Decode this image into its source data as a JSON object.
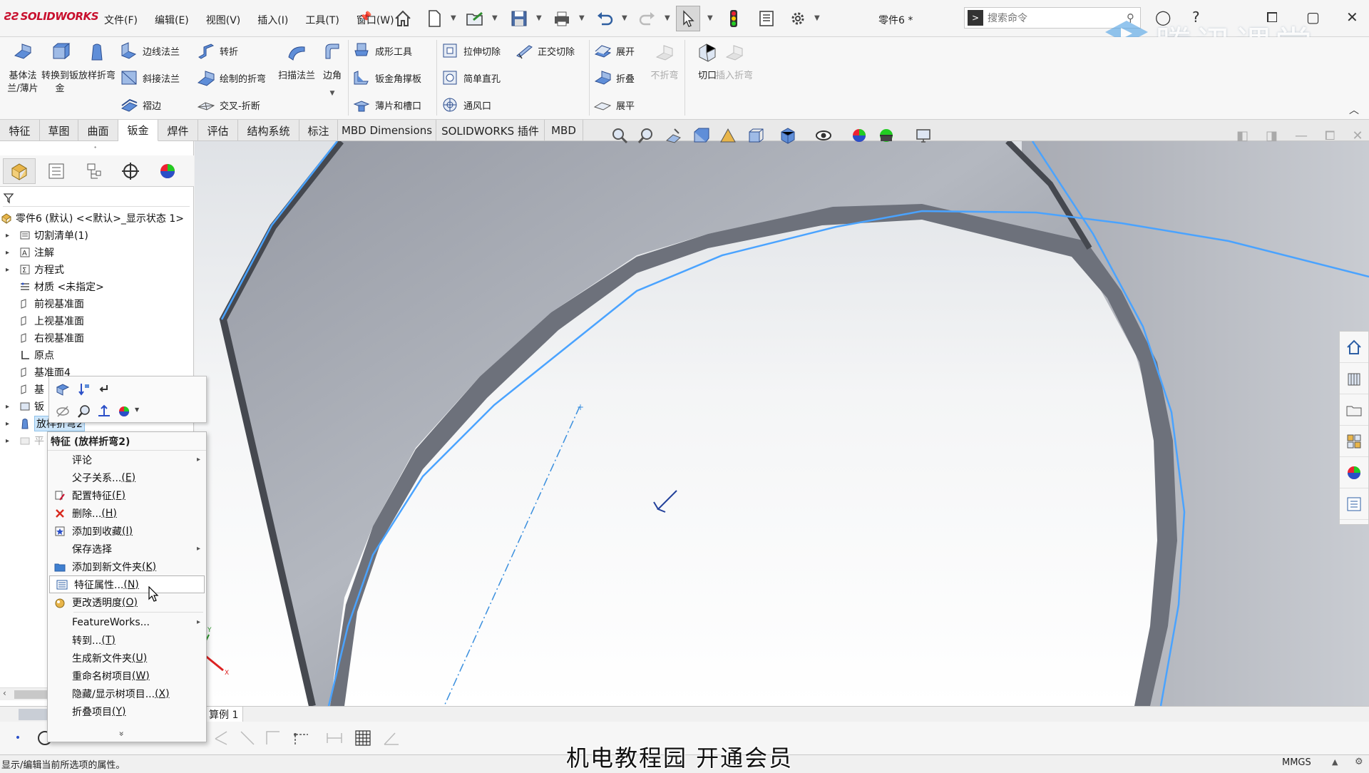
{
  "titlebar": {
    "logo": "SOLIDWORKS",
    "menus": [
      "文件(F)",
      "编辑(E)",
      "视图(V)",
      "插入(I)",
      "工具(T)",
      "窗口(W)"
    ],
    "doc_title": "零件6 *",
    "search_placeholder": "搜索命令",
    "watermark": "腾讯课堂"
  },
  "ribbon": {
    "big": [
      {
        "label": "基体法兰/薄片",
        "icon": "base-flange-icon"
      },
      {
        "label": "转换到钣金",
        "icon": "convert-sheetmetal-icon"
      },
      {
        "label": "放样折弯",
        "icon": "lofted-bend-icon"
      }
    ],
    "col1": [
      "边线法兰",
      "斜接法兰",
      "褶边"
    ],
    "col2": [
      "转折",
      "绘制的折弯",
      "交叉-折断"
    ],
    "big2": [
      {
        "label": "扫描法兰",
        "icon": "swept-flange-icon"
      },
      {
        "label": "边角",
        "icon": "corner-icon"
      }
    ],
    "col3": [
      "成形工具",
      "钣金角撑板",
      "薄片和槽口"
    ],
    "col4": [
      "拉伸切除",
      "简单直孔",
      "通风口"
    ],
    "col5": [
      "正交切除"
    ],
    "col6": [
      "展开",
      "折叠",
      "展平"
    ],
    "big3": [
      {
        "label": "不折弯",
        "icon": "no-bends-icon",
        "disabled": true
      },
      {
        "label": "切口",
        "icon": "rip-icon",
        "disabled": false
      },
      {
        "label": "插入折弯",
        "icon": "insert-bends-icon",
        "disabled": true
      }
    ]
  },
  "tabs": [
    "特征",
    "草图",
    "曲面",
    "钣金",
    "焊件",
    "评估",
    "结构系统",
    "标注",
    "MBD Dimensions",
    "SOLIDWORKS 插件",
    "MBD"
  ],
  "active_tab": "钣金",
  "tree": {
    "root": "零件6 (默认) <<默认>_显示状态 1>",
    "nodes": [
      {
        "label": "切割清单(1)",
        "icon": "cutlist-icon",
        "expandable": true
      },
      {
        "label": "注解",
        "icon": "annotations-icon",
        "expandable": true
      },
      {
        "label": "方程式",
        "icon": "equations-icon",
        "expandable": true
      },
      {
        "label": "材质 <未指定>",
        "icon": "material-icon",
        "expandable": false
      },
      {
        "label": "前视基准面",
        "icon": "plane-icon",
        "expandable": false
      },
      {
        "label": "上视基准面",
        "icon": "plane-icon",
        "expandable": false
      },
      {
        "label": "右视基准面",
        "icon": "plane-icon",
        "expandable": false
      },
      {
        "label": "原点",
        "icon": "origin-icon",
        "expandable": false
      },
      {
        "label": "基准面4",
        "icon": "plane-icon",
        "expandable": false
      },
      {
        "label": "基",
        "icon": "plane-icon",
        "expandable": false
      },
      {
        "label": "钣",
        "icon": "sheetmetal-icon",
        "expandable": true
      },
      {
        "label": "放样折弯2",
        "icon": "lofted-bend-icon",
        "expandable": true,
        "selected": true
      },
      {
        "label": "平",
        "icon": "flat-pattern-icon",
        "expandable": true,
        "greyed": true
      }
    ]
  },
  "context_menu": {
    "header": "特征 (放样折弯2)",
    "items": [
      {
        "label": "评论",
        "key": "",
        "submenu": true,
        "icon": ""
      },
      {
        "label": "父子关系... ",
        "key": "(E)",
        "icon": ""
      },
      {
        "label": "配置特征 ",
        "key": "(F)",
        "icon": "configure-feature-icon"
      },
      {
        "label": "删除... ",
        "key": "(H)",
        "icon": "delete-icon"
      },
      {
        "label": "添加到收藏 ",
        "key": "(I)",
        "icon": "favorite-icon"
      },
      {
        "label": "保存选择",
        "key": "",
        "submenu": true,
        "icon": ""
      },
      {
        "label": "添加到新文件夹 ",
        "key": "(K)",
        "icon": "new-folder-icon"
      },
      {
        "label": "特征属性... ",
        "key": "(N)",
        "icon": "feature-properties-icon",
        "hover": true
      },
      {
        "label": "更改透明度 ",
        "key": "(O)",
        "icon": "transparency-icon"
      },
      {
        "label": "FeatureWorks...",
        "key": "",
        "submenu": true,
        "icon": ""
      },
      {
        "label": "转到... ",
        "key": "(T)",
        "icon": ""
      },
      {
        "label": "生成新文件夹 ",
        "key": "(U)",
        "icon": ""
      },
      {
        "label": "重命名树项目 ",
        "key": "(W)",
        "icon": ""
      },
      {
        "label": "隐藏/显示树项目... ",
        "key": "(X)",
        "icon": ""
      },
      {
        "label": "折叠项目 ",
        "key": "(Y)",
        "icon": ""
      }
    ],
    "more": "»"
  },
  "bottom_tab": "算例 1",
  "status": {
    "text": "显示/编辑当前所选项的属性。",
    "units": "MMGS"
  },
  "subtitle": "机电教程园  开通会员",
  "colors": {
    "accent_blue": "#3a8fde",
    "edge_blue": "#4aa3ff",
    "logo_red": "#c8102e"
  }
}
